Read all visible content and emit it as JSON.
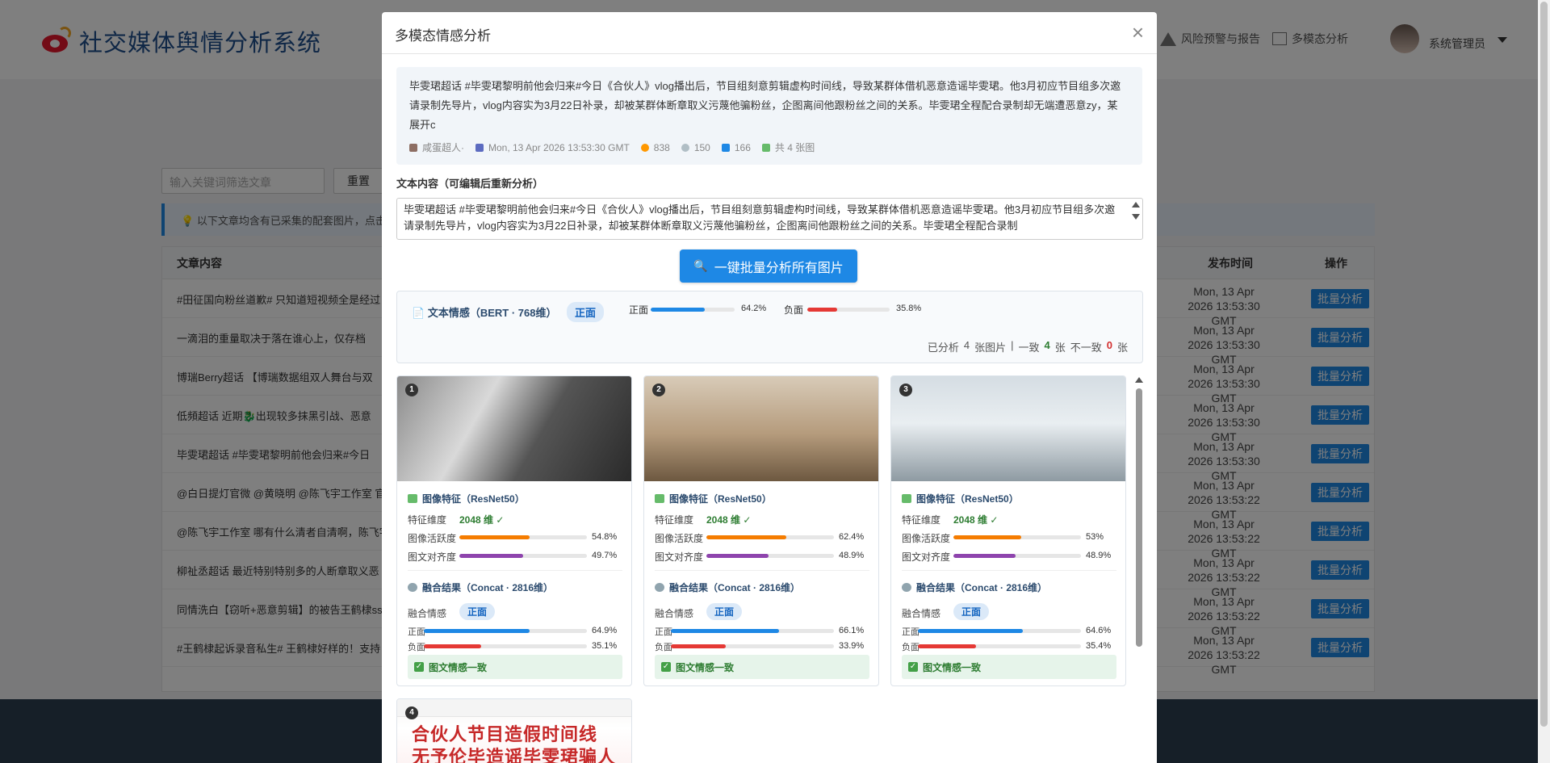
{
  "app": {
    "title": "社交媒体舆情分析系统",
    "nav": [
      {
        "label": "风险预警与报告",
        "icon": "warning-icon"
      },
      {
        "label": "多模态分析",
        "icon": "image-icon"
      }
    ],
    "user": "系统管理员"
  },
  "filter": {
    "placeholder": "输入关键词筛选文章",
    "reset": "重置"
  },
  "tip": "以下文章均含有已采集的配套图片，点击",
  "table": {
    "headers": {
      "content": "文章内容",
      "time": "发布时间",
      "action": "操作"
    },
    "rows": [
      {
        "content": "#田征国向粉丝道歉# 只知道短视频全是经过",
        "time": "Mon, 13 Apr 2026 13:53:30 GMT",
        "action": "批量分析"
      },
      {
        "content": "一滴泪的重量取决于落在谁心上，仅存档",
        "time": "Mon, 13 Apr 2026 13:53:30 GMT",
        "action": "批量分析"
      },
      {
        "content": "博瑞Berry超话 【博瑞数据组双人舞台与双",
        "time": "Mon, 13 Apr 2026 13:53:30 GMT",
        "action": "批量分析"
      },
      {
        "content": "低頻超话 近期🐉出现较多抹黑引战、恶意",
        "time": "Mon, 13 Apr 2026 13:53:30 GMT",
        "action": "批量分析"
      },
      {
        "content": "毕雯珺超话 #毕雯珺黎明前他会归来#今日",
        "time": "Mon, 13 Apr 2026 13:53:30 GMT",
        "action": "批量分析"
      },
      {
        "content": "@白日提灯官微 @黄晓明 @陈飞宇工作室 官",
        "time": "Mon, 13 Apr 2026 13:53:22 GMT",
        "action": "批量分析"
      },
      {
        "content": "@陈飞宇工作室 哪有什么清者自清啊，陈飞宇",
        "time": "Mon, 13 Apr 2026 13:53:22 GMT",
        "action": "批量分析"
      },
      {
        "content": "柳祉丞超话 最近特别特别多的人断章取义恶",
        "time": "Mon, 13 Apr 2026 13:53:22 GMT",
        "action": "批量分析"
      },
      {
        "content": "同情洗白【窃听+恶意剪辑】的被告王鹤棣ss",
        "time": "Mon, 13 Apr 2026 13:53:22 GMT",
        "action": "批量分析"
      },
      {
        "content": "#王鹤棣起诉录音私生# 王鹤棣好样的！支持",
        "time": "Mon, 13 Apr 2026 13:53:22 GMT",
        "action": "批量分析"
      }
    ]
  },
  "modal": {
    "title": "多模态情感分析",
    "close": "×",
    "post": {
      "text": "毕雯珺超话 #毕雯珺黎明前他会归来#今日《合伙人》vlog播出后，节目组刻意剪辑虚构时间线，导致某群体借机恶意造谣毕雯珺。他3月初应节目组多次邀请录制先导片，vlog内容实为3月22日补录，却被某群体断章取义污蔑他骗粉丝，企图离间他跟粉丝之间的关系。毕雯珺全程配合录制却无端遭恶意zy，某 展开c",
      "author": "咸蛋超人·",
      "date": "Mon, 13 Apr 2026 13:53:30 GMT",
      "likes": "838",
      "comments": "150",
      "reposts": "166",
      "images": "共 4 张图"
    },
    "text_label": "文本内容（可编辑后重新分析）",
    "textarea": "毕雯珺超话 #毕雯珺黎明前他会归来#今日《合伙人》vlog播出后，节目组刻意剪辑虚构时间线，导致某群体借机恶意造谣毕雯珺。他3月初应节目组多次邀请录制先导片，vlog内容实为3月22日补录，却被某群体断章取义污蔑他骗粉丝，企图离间他跟粉丝之间的关系。毕雯珺全程配合录制",
    "batch_button": "一键批量分析所有图片",
    "text_sentiment": {
      "label": "文本情感（BERT · 768维）",
      "result": "正面",
      "positive_label": "正面",
      "positive": 64.2,
      "positive_text": "64.2%",
      "negative_label": "负面",
      "negative": 35.8,
      "negative_text": "35.8%"
    },
    "summary": {
      "prefix": "已分析",
      "count": "4",
      "unit": "张图片",
      "sep": "|",
      "consistent_label": "一致",
      "consistent": "4",
      "consistent_unit": "张",
      "inconsistent_label": "不一致",
      "inconsistent": "0",
      "inconsistent_unit": "张"
    },
    "cards": [
      {
        "index": "1",
        "feature_title": "图像特征（ResNet50）",
        "dim_label": "特征维度",
        "dim": "2048 维 ✓",
        "activity_label": "图像活跃度",
        "activity": 54.8,
        "activity_text": "54.8%",
        "align_label": "图文对齐度",
        "align": 49.7,
        "align_text": "49.7%",
        "fused_title": "融合结果（Concat · 2816维）",
        "fused_label": "融合情感",
        "fused": "正面",
        "pos_label": "正面",
        "pos": 64.9,
        "pos_text": "64.9%",
        "neg_label": "负面",
        "neg": 35.1,
        "neg_text": "35.1%",
        "consistent": "图文情感一致"
      },
      {
        "index": "2",
        "feature_title": "图像特征（ResNet50）",
        "dim_label": "特征维度",
        "dim": "2048 维 ✓",
        "activity_label": "图像活跃度",
        "activity": 62.4,
        "activity_text": "62.4%",
        "align_label": "图文对齐度",
        "align": 48.9,
        "align_text": "48.9%",
        "fused_title": "融合结果（Concat · 2816维）",
        "fused_label": "融合情感",
        "fused": "正面",
        "pos_label": "正面",
        "pos": 66.1,
        "pos_text": "66.1%",
        "neg_label": "负面",
        "neg": 33.9,
        "neg_text": "33.9%",
        "consistent": "图文情感一致"
      },
      {
        "index": "3",
        "feature_title": "图像特征（ResNet50）",
        "dim_label": "特征维度",
        "dim": "2048 维 ✓",
        "activity_label": "图像活跃度",
        "activity": 53,
        "activity_text": "53%",
        "align_label": "图文对齐度",
        "align": 48.9,
        "align_text": "48.9%",
        "fused_title": "融合结果（Concat · 2816维）",
        "fused_label": "融合情感",
        "fused": "正面",
        "pos_label": "正面",
        "pos": 64.6,
        "pos_text": "64.6%",
        "neg_label": "负面",
        "neg": 35.4,
        "neg_text": "35.4%",
        "consistent": "图文情感一致"
      }
    ],
    "card4": {
      "index": "4",
      "line1": "合伙人节目造假时间线",
      "line2": "无予伦毕造谣毕雯珺骗人"
    },
    "colors": {
      "accent": "#1e88e5",
      "activity": "#f57c00",
      "align": "#8e44ad",
      "positive": "#1e88e5",
      "negative": "#e53935",
      "ok": "#2e7d32"
    }
  }
}
